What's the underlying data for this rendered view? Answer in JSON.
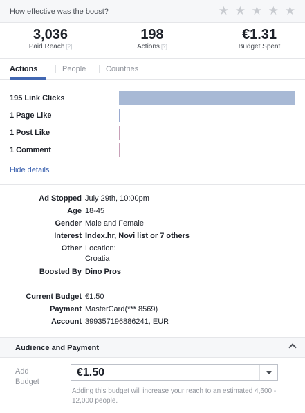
{
  "feedback": {
    "question": "How effective was the boost?",
    "stars": [
      "★",
      "★",
      "★",
      "★",
      "★"
    ]
  },
  "stats": [
    {
      "value": "3,036",
      "label": "Paid Reach",
      "hint": "[?]"
    },
    {
      "value": "198",
      "label": "Actions",
      "hint": "[?]"
    },
    {
      "value": "€1.31",
      "label": "Budget Spent",
      "hint": ""
    }
  ],
  "tabs": {
    "actions": "Actions",
    "people": "People",
    "countries": "Countries"
  },
  "actions": {
    "rows": [
      {
        "label": "195 Link Clicks",
        "value": 195
      },
      {
        "label": "1 Page Like",
        "value": 1
      },
      {
        "label": "1 Post Like",
        "value": 1
      },
      {
        "label": "1 Comment",
        "value": 1
      }
    ],
    "max": 195,
    "colors": [
      "#a8b9d5",
      "#9aaad0",
      "#c8a0b8",
      "#c8a0b8"
    ],
    "hide_details": "Hide details"
  },
  "details": {
    "ad_stopped_label": "Ad Stopped",
    "ad_stopped_value": "July 29th, 10:00pm",
    "age_label": "Age",
    "age_value": "18-45",
    "gender_label": "Gender",
    "gender_value": "Male and Female",
    "interest_label": "Interest",
    "interest_value": "Index.hr, Novi list or 7 others",
    "other_label": "Other",
    "other_value_1": "Location:",
    "other_value_2": "Croatia",
    "boosted_by_label": "Boosted By",
    "boosted_by_value": "Dino Pros",
    "current_budget_label": "Current Budget",
    "current_budget_value": "€1.50",
    "payment_label": "Payment",
    "payment_value": "MasterCard(*** 8569)",
    "account_label": "Account",
    "account_value": "399357196886241, EUR"
  },
  "audience": {
    "title": "Audience and Payment",
    "add_budget_line1": "Add",
    "add_budget_line2": "Budget",
    "budget_value": "€1.50",
    "help": "Adding this budget will increase your reach to an estimated 4,600 - 12,000 people."
  }
}
